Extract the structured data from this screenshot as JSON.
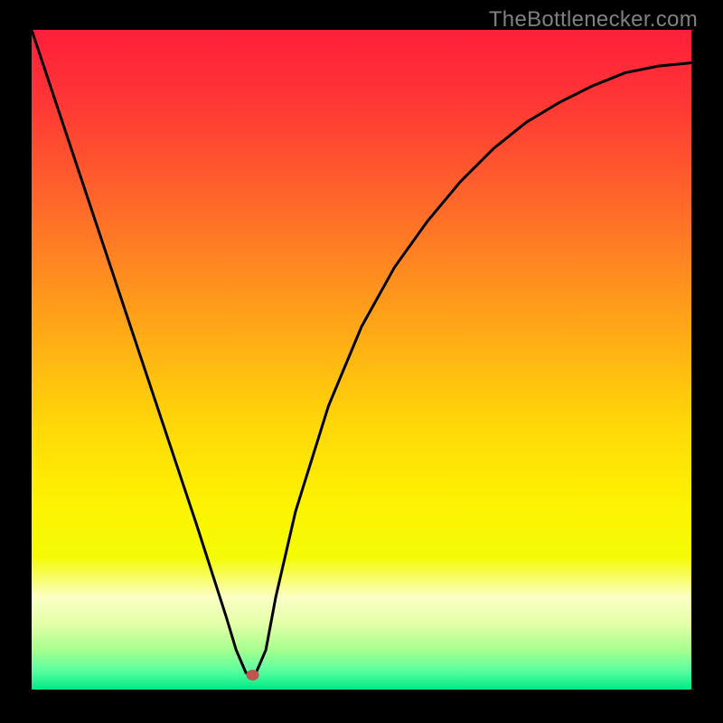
{
  "watermark": "TheBottlenecker.com",
  "marker": {
    "x_frac": 0.335,
    "y_frac": 0.978,
    "color": "#c1544c",
    "rx": 7,
    "ry": 6
  },
  "gradient_stops": [
    {
      "offset": 0.0,
      "color": "#ff1f3a"
    },
    {
      "offset": 0.1,
      "color": "#ff3436"
    },
    {
      "offset": 0.22,
      "color": "#ff5a2d"
    },
    {
      "offset": 0.35,
      "color": "#ff8522"
    },
    {
      "offset": 0.48,
      "color": "#ffb114"
    },
    {
      "offset": 0.6,
      "color": "#ffd808"
    },
    {
      "offset": 0.72,
      "color": "#fdf301"
    },
    {
      "offset": 0.8,
      "color": "#f4fb05"
    },
    {
      "offset": 0.86,
      "color": "#fbffc5"
    },
    {
      "offset": 0.9,
      "color": "#e3ffa8"
    },
    {
      "offset": 0.94,
      "color": "#a6ff8e"
    },
    {
      "offset": 0.97,
      "color": "#5dffa0"
    },
    {
      "offset": 1.0,
      "color": "#00e886"
    }
  ],
  "chart_data": {
    "type": "line",
    "title": "",
    "xlabel": "",
    "ylabel": "",
    "xlim": [
      0,
      1
    ],
    "ylim": [
      0,
      1
    ],
    "note": "Axes are unlabeled in the source image; x and y are normalized fractions of the plot area. y=1 corresponds to the top (red) and y=0 to the bottom (green).",
    "series": [
      {
        "name": "bottleneck-curve",
        "x": [
          0.0,
          0.05,
          0.1,
          0.15,
          0.2,
          0.25,
          0.295,
          0.31,
          0.325,
          0.34,
          0.355,
          0.37,
          0.4,
          0.45,
          0.5,
          0.55,
          0.6,
          0.65,
          0.7,
          0.75,
          0.8,
          0.85,
          0.9,
          0.95,
          1.0
        ],
        "y": [
          1.0,
          0.85,
          0.7,
          0.55,
          0.4,
          0.25,
          0.11,
          0.06,
          0.025,
          0.025,
          0.06,
          0.14,
          0.27,
          0.43,
          0.55,
          0.64,
          0.71,
          0.77,
          0.82,
          0.86,
          0.89,
          0.915,
          0.935,
          0.945,
          0.95
        ]
      }
    ],
    "marker_point": {
      "x": 0.335,
      "y": 0.022
    }
  }
}
